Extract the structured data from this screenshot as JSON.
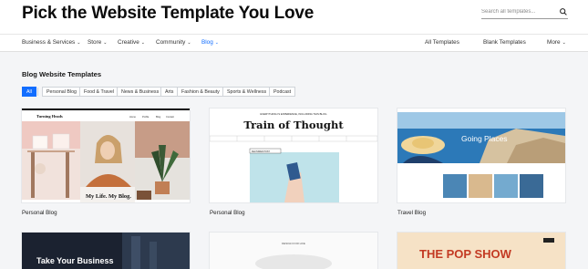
{
  "header": {
    "title": "Pick the Website Template You Love",
    "search_placeholder": "Search all templates..."
  },
  "nav": {
    "left": [
      {
        "label": "Business & Services"
      },
      {
        "label": "Store"
      },
      {
        "label": "Creative"
      },
      {
        "label": "Community"
      },
      {
        "label": "Blog"
      }
    ],
    "right": [
      {
        "label": "All Templates"
      },
      {
        "label": "Blank Templates"
      },
      {
        "label": "More"
      }
    ]
  },
  "section": {
    "title": "Blog Website Templates",
    "filters": [
      "All",
      "Personal Blog",
      "Food & Travel",
      "News & Business",
      "Arts",
      "Fashion & Beauty",
      "Sports & Wellness",
      "Podcast"
    ]
  },
  "templates": [
    {
      "label": "Personal Blog",
      "thumb": {
        "brand": "Turning Heads",
        "menu": [
          "Home",
          "Profile",
          "Blog",
          "Contact"
        ],
        "headline": "My Life. My Blog."
      }
    },
    {
      "label": "Personal Blog",
      "thumb": {
        "tagline": "EVERYTHING IS EXPERIENCE, INCLUDING THIS BLOG",
        "headline": "Train of Thought",
        "badge": "FEATURED POST"
      }
    },
    {
      "label": "Travel Blog",
      "thumb": {
        "headline": "Going Places"
      }
    }
  ],
  "templates_row2": [
    {
      "headline": "Take Your Business"
    },
    {
      "caption": "DESIGN FOR LIFE"
    },
    {
      "headline": "THE POP SHOW"
    }
  ],
  "colors": {
    "accent": "#116dff",
    "page_bg": "#f4f5f7"
  }
}
